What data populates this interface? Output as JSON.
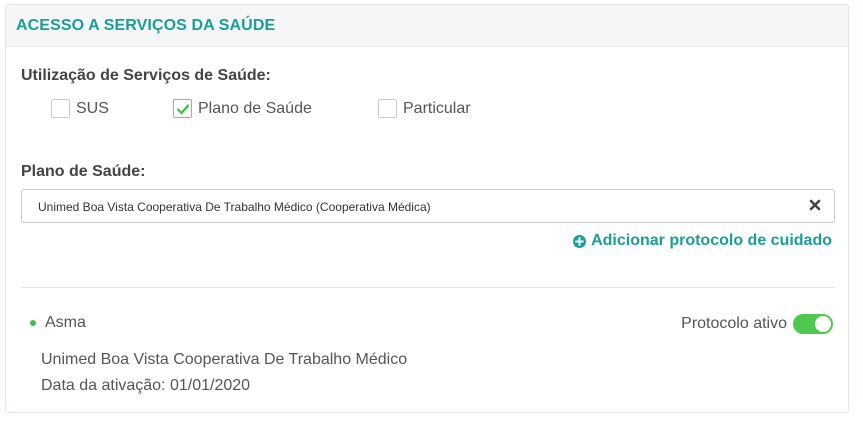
{
  "section": {
    "title": "ACESSO A SERVIÇOS DA SAÚDE"
  },
  "utilizacao": {
    "label": "Utilização de Serviços de Saúde:",
    "options": [
      {
        "label": "SUS",
        "checked": false
      },
      {
        "label": "Plano de Saúde",
        "checked": true
      },
      {
        "label": "Particular",
        "checked": false
      }
    ]
  },
  "plano": {
    "label": "Plano de Saúde:",
    "selected_value": "Unimed Boa Vista Cooperativa De Trabalho Médico (Cooperativa Médica)",
    "clear_icon": "close-icon"
  },
  "add_protocol": {
    "label": "Adicionar protocolo de cuidado",
    "icon": "plus-circle-icon"
  },
  "protocol": {
    "name": "Asma",
    "status_label": "Protocolo ativo",
    "active": true,
    "provider": "Unimed Boa Vista Cooperativa De Trabalho Médico",
    "activation": "Data da ativação: 01/01/2020"
  },
  "colors": {
    "accent": "#1a9e97",
    "toggle_on": "#4fc84f",
    "status_dot": "#3fbf4a"
  }
}
